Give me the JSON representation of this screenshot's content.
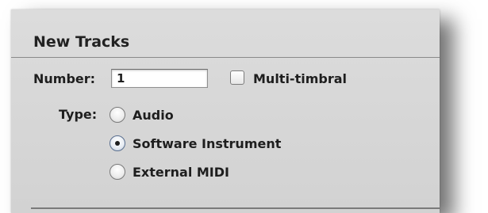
{
  "dialog": {
    "title": "New Tracks"
  },
  "number": {
    "label": "Number:",
    "value": "1"
  },
  "multi_timbral": {
    "label": "Multi-timbral",
    "checked": false
  },
  "type": {
    "label": "Type:",
    "options": [
      {
        "label": "Audio",
        "selected": false
      },
      {
        "label": "Software Instrument",
        "selected": true
      },
      {
        "label": "External MIDI",
        "selected": false
      }
    ]
  },
  "colors": {
    "panel": "#d6d6d6",
    "text": "#1e1e1e",
    "radio_selected_ring": "#5a6f8f"
  }
}
